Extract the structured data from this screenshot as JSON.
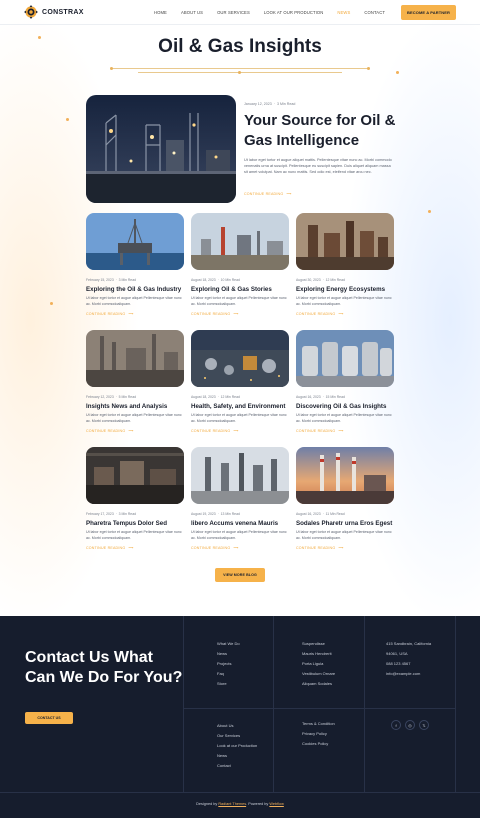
{
  "header": {
    "logo_text": "CONSTRAX",
    "nav": [
      {
        "label": "HOME",
        "active": false
      },
      {
        "label": "ABOUT US",
        "active": false
      },
      {
        "label": "OUR SERVICES",
        "active": false
      },
      {
        "label": "LOOK AT OUR PRODUCTION",
        "active": false
      },
      {
        "label": "NEWS",
        "active": true
      },
      {
        "label": "CONTACT",
        "active": false
      }
    ],
    "cta_label": "BECOME A PARTNER"
  },
  "page_title": "Oil & Gas Insights",
  "featured": {
    "date": "January 12, 2023",
    "read_time": "3 Min Read",
    "title": "Your Source for Oil & Gas Intelligence",
    "excerpt": "Ut labor eget tortor et augue aliquet mattis. Pellentesque vitae nunc ac. Morbi commodo venenatis urna at suscipit. Pellentesque eu suscipit sapien. Duis aliquet aliquam massa sit amet volutpat. Nam ac nunc mattis. Sed odio est, eleifend vitae arcu nec.",
    "read_more": "CONTINUE READING"
  },
  "posts": [
    {
      "date": "February 15, 2023",
      "read_time": "3 Min Read",
      "title": "Exploring the Oil & Gas Industry",
      "excerpt": "Ut labor eget tortor et augue aliquet Pellentesque vitae nunc ac. Morbi commodoaliquam.",
      "read_more": "CONTINUE READING",
      "image": "offshore-platform"
    },
    {
      "date": "August 18, 2023",
      "read_time": "10 Min Read",
      "title": "Exploring Oil & Gas Stories",
      "excerpt": "Ut labor eget tortor et augue aliquet Pellentesque vitae nunc ac. Morbi commodoaliquam.",
      "read_more": "CONTINUE READING",
      "image": "refinery-field"
    },
    {
      "date": "August 30, 2023",
      "read_time": "12 Min Read",
      "title": "Exploring Energy Ecosystems",
      "excerpt": "Ut labor eget tortor et augue aliquet Pellentesque vitae nunc ac. Morbi commodoaliquam.",
      "read_more": "CONTINUE READING",
      "image": "rusty-plant"
    },
    {
      "date": "February 12, 2023",
      "read_time": "5 Min Read",
      "title": "Insights News and Analysis",
      "excerpt": "Ut labor eget tortor et augue aliquet Pellentesque vitae nunc ac. Morbi commodoaliquam.",
      "read_more": "CONTINUE READING",
      "image": "industrial-chimneys"
    },
    {
      "date": "August 18, 2023",
      "read_time": "12 Min Read",
      "title": "Health, Safety, and Environment",
      "excerpt": "Ut labor eget tortor et augue aliquet Pellentesque vitae nunc ac. Morbi commodoaliquam.",
      "read_more": "CONTINUE READING",
      "image": "aerial-plant"
    },
    {
      "date": "August 16, 2023",
      "read_time": "15 Min Read",
      "title": "Discovering Oil & Gas Insights",
      "excerpt": "Ut labor eget tortor et augue aliquet Pellentesque vitae nunc ac. Morbi commodoaliquam.",
      "read_more": "CONTINUE READING",
      "image": "silver-tanks"
    },
    {
      "date": "February 17, 2023",
      "read_time": "3 Min Read",
      "title": "Pharetra Tempus Dolor Sed",
      "excerpt": "Ut labor eget tortor et augue aliquet Pellentesque vitae nunc ac. Morbi commodoaliquam.",
      "read_more": "CONTINUE READING",
      "image": "factory-interior"
    },
    {
      "date": "August 19, 2023",
      "read_time": "13 Min Read",
      "title": "libero Accums venena Mauris",
      "excerpt": "Ut labor eget tortor et augue aliquet Pellentesque vitae nunc ac. Morbi commodoaliquam.",
      "read_more": "CONTINUE READING",
      "image": "pipes-columns"
    },
    {
      "date": "August 16, 2023",
      "read_time": "11 Min Read",
      "title": "Sodales Pharetr urna Eros Egest",
      "excerpt": "Ut labor eget tortor et augue aliquet Pellentesque vitae nunc ac. Morbi commodoaliquam.",
      "read_more": "CONTINUE READING",
      "image": "power-plant-sunset"
    }
  ],
  "view_more_label": "VIEW MORE BLOG",
  "footer": {
    "heading": "Contact Us What Can We Do For You?",
    "contact_button": "CONTACT US",
    "col1": [
      "What We Do",
      "News",
      "Projects",
      "Faq",
      "Store"
    ],
    "col2": [
      "Suspendisse",
      "Mauris Hendrerit",
      "Porta Ligula",
      "Vestibulum Ornare",
      "Aliquam Sodales"
    ],
    "col3": [
      "415 Sandbrain, California",
      "94061, USA",
      "088 123 4567",
      "info@example.com"
    ],
    "col4": [
      "About Us",
      "Our Services",
      "Look at our Production",
      "News",
      "Contact"
    ],
    "col5": [
      "Terms & Condition",
      "Privacy Policy",
      "Cookies Policy"
    ],
    "socials": [
      "facebook-icon",
      "instagram-icon",
      "x-icon"
    ],
    "credit_prefix": "Designed by",
    "credit_author": "Radiant Themes",
    "credit_mid": ". Powered by",
    "credit_platform": "Webflow"
  },
  "colors": {
    "accent": "#f6b24a",
    "footer_bg": "#161d2d",
    "text_dark": "#1a1f2c"
  }
}
